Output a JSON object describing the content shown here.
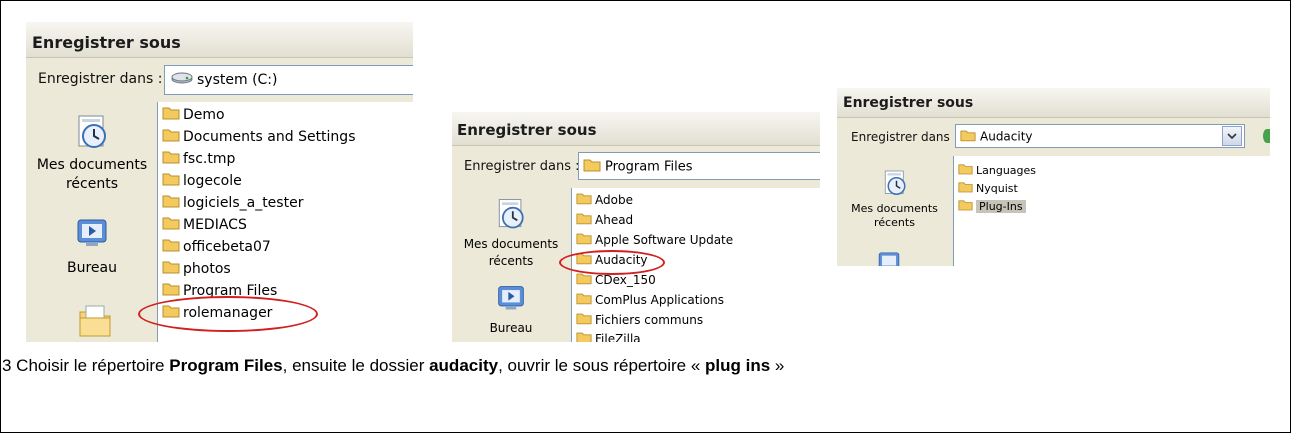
{
  "dialog1": {
    "title": "Enregistrer sous",
    "save_in_label": "Enregistrer dans :",
    "location": "system (C:)",
    "places": [
      "Mes documents récents",
      "Bureau"
    ],
    "items": [
      "Demo",
      "Documents and Settings",
      "fsc.tmp",
      "logecole",
      "logiciels_a_tester",
      "MEDIACS",
      "officebeta07",
      "photos",
      "Program Files",
      "rolemanager"
    ]
  },
  "dialog2": {
    "title": "Enregistrer sous",
    "save_in_label": "Enregistrer dans :",
    "location": "Program Files",
    "places": [
      "Mes documents récents",
      "Bureau"
    ],
    "items": [
      "Adobe",
      "Ahead",
      "Apple Software Update",
      "Audacity",
      "CDex_150",
      "ComPlus Applications",
      "Fichiers communs",
      "FileZilla"
    ]
  },
  "dialog3": {
    "title": "Enregistrer sous",
    "save_in_label": "Enregistrer dans :",
    "location": "Audacity",
    "places": [
      "Mes documents récents"
    ],
    "items": [
      "Languages",
      "Nyquist",
      "Plug-Ins"
    ],
    "selected_item": "Plug-Ins"
  },
  "caption": {
    "prefix": "3 Choisir le répertoire ",
    "program_files": "Program Files",
    "middle": ", ensuite le dossier ",
    "audacity": "audacity",
    "after_audacity": ", ouvrir le sous répertoire « ",
    "plug_ins": "plug ins",
    "suffix": " »"
  },
  "colors": {
    "annotation_circle": "#d21f1f",
    "folder": "#f4c95d",
    "dialog_bg": "#ece9d8"
  },
  "icons": {
    "folder": "folder-icon",
    "drive": "hard-drive-icon",
    "recent": "recent-documents-icon",
    "desktop": "desktop-icon"
  }
}
